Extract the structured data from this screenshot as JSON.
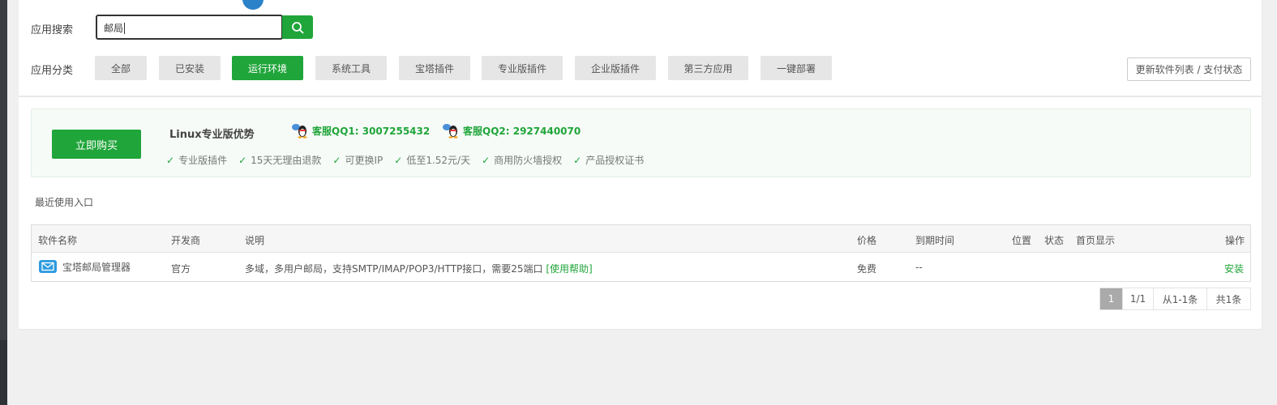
{
  "search": {
    "label": "应用搜索",
    "value": "邮局"
  },
  "categories": {
    "label": "应用分类",
    "items": [
      {
        "label": "全部",
        "active": false
      },
      {
        "label": "已安装",
        "active": false
      },
      {
        "label": "运行环境",
        "active": true
      },
      {
        "label": "系统工具",
        "active": false
      },
      {
        "label": "宝塔插件",
        "active": false
      },
      {
        "label": "专业版插件",
        "active": false
      },
      {
        "label": "企业版插件",
        "active": false
      },
      {
        "label": "第三方应用",
        "active": false
      },
      {
        "label": "一键部署",
        "active": false
      }
    ]
  },
  "update_button": "更新软件列表 / 支付状态",
  "promo": {
    "buy_button": "立即购买",
    "title": "Linux专业版优势",
    "qq1": "客服QQ1: 3007255432",
    "qq2": "客服QQ2: 2927440070",
    "features": [
      "专业版插件",
      "15天无理由退款",
      "可更换IP",
      "低至1.52元/天",
      "商用防火墙授权",
      "产品授权证书"
    ]
  },
  "recent_label": "最近使用入口",
  "table": {
    "headers": {
      "name": "软件名称",
      "developer": "开发商",
      "description": "说明",
      "price": "价格",
      "expiry": "到期时间",
      "location": "位置",
      "status": "状态",
      "homepage": "首页显示",
      "action": "操作"
    },
    "rows": [
      {
        "name": "宝塔邮局管理器",
        "icon": "mail-icon",
        "developer": "官方",
        "description": "多域，多用户邮局，支持SMTP/IMAP/POP3/HTTP接口，需要25端口",
        "help_link": "[使用帮助]",
        "price": "免费",
        "expiry": "--",
        "action": "安装"
      }
    ]
  },
  "pagination": {
    "current": "1",
    "pages": "1/1",
    "range": "从1-1条",
    "total": "共1条"
  },
  "colors": {
    "accent": "#20a53a",
    "icon_blue": "#2c9be0"
  }
}
